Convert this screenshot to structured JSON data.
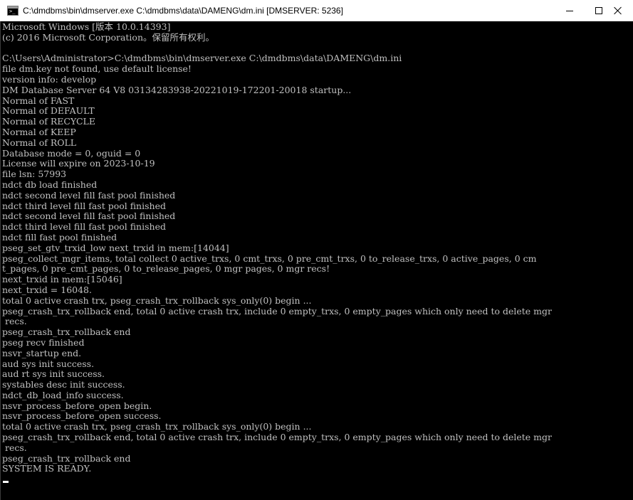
{
  "window": {
    "title": "C:\\dmdbms\\bin\\dmserver.exe C:\\dmdbms\\data\\DAMENG\\dm.ini [DMSERVER: 5236]",
    "icon": "console-icon",
    "controls": {
      "minimize": "minimize-icon",
      "maximize": "maximize-icon",
      "close": "close-icon"
    },
    "colors": {
      "titlebar_bg": "#ffffff",
      "console_bg": "#000000",
      "console_fg": "#c0c0c0"
    }
  },
  "console": {
    "lines": [
      "Microsoft Windows [版本 10.0.14393]",
      "(c) 2016 Microsoft Corporation。保留所有权利。",
      "",
      "C:\\Users\\Administrator>C:\\dmdbms\\bin\\dmserver.exe C:\\dmdbms\\data\\DAMENG\\dm.ini",
      "file dm.key not found, use default license!",
      "version info: develop",
      "DM Database Server 64 V8 03134283938-20221019-172201-20018 startup...",
      "Normal of FAST",
      "Normal of DEFAULT",
      "Normal of RECYCLE",
      "Normal of KEEP",
      "Normal of ROLL",
      "Database mode = 0, oguid = 0",
      "License will expire on 2023-10-19",
      "file lsn: 57993",
      "ndct db load finished",
      "ndct second level fill fast pool finished",
      "ndct third level fill fast pool finished",
      "ndct second level fill fast pool finished",
      "ndct third level fill fast pool finished",
      "ndct fill fast pool finished",
      "pseg_set_gtv_trxid_low next_trxid in mem:[14044]",
      "pseg_collect_mgr_items, total collect 0 active_trxs, 0 cmt_trxs, 0 pre_cmt_trxs, 0 to_release_trxs, 0 active_pages, 0 cm",
      "t_pages, 0 pre_cmt_pages, 0 to_release_pages, 0 mgr pages, 0 mgr recs!",
      "next_trxid in mem:[15046]",
      "next_trxid = 16048.",
      "total 0 active crash trx, pseg_crash_trx_rollback sys_only(0) begin ...",
      "pseg_crash_trx_rollback end, total 0 active crash trx, include 0 empty_trxs, 0 empty_pages which only need to delete mgr",
      " recs.",
      "pseg_crash_trx_rollback end",
      "pseg recv finished",
      "nsvr_startup end.",
      "aud sys init success.",
      "aud rt sys init success.",
      "systables desc init success.",
      "ndct_db_load_info success.",
      "nsvr_process_before_open begin.",
      "nsvr_process_before_open success.",
      "total 0 active crash trx, pseg_crash_trx_rollback sys_only(0) begin ...",
      "pseg_crash_trx_rollback end, total 0 active crash trx, include 0 empty_trxs, 0 empty_pages which only need to delete mgr",
      " recs.",
      "pseg_crash_trx_rollback end",
      "SYSTEM IS READY."
    ]
  }
}
